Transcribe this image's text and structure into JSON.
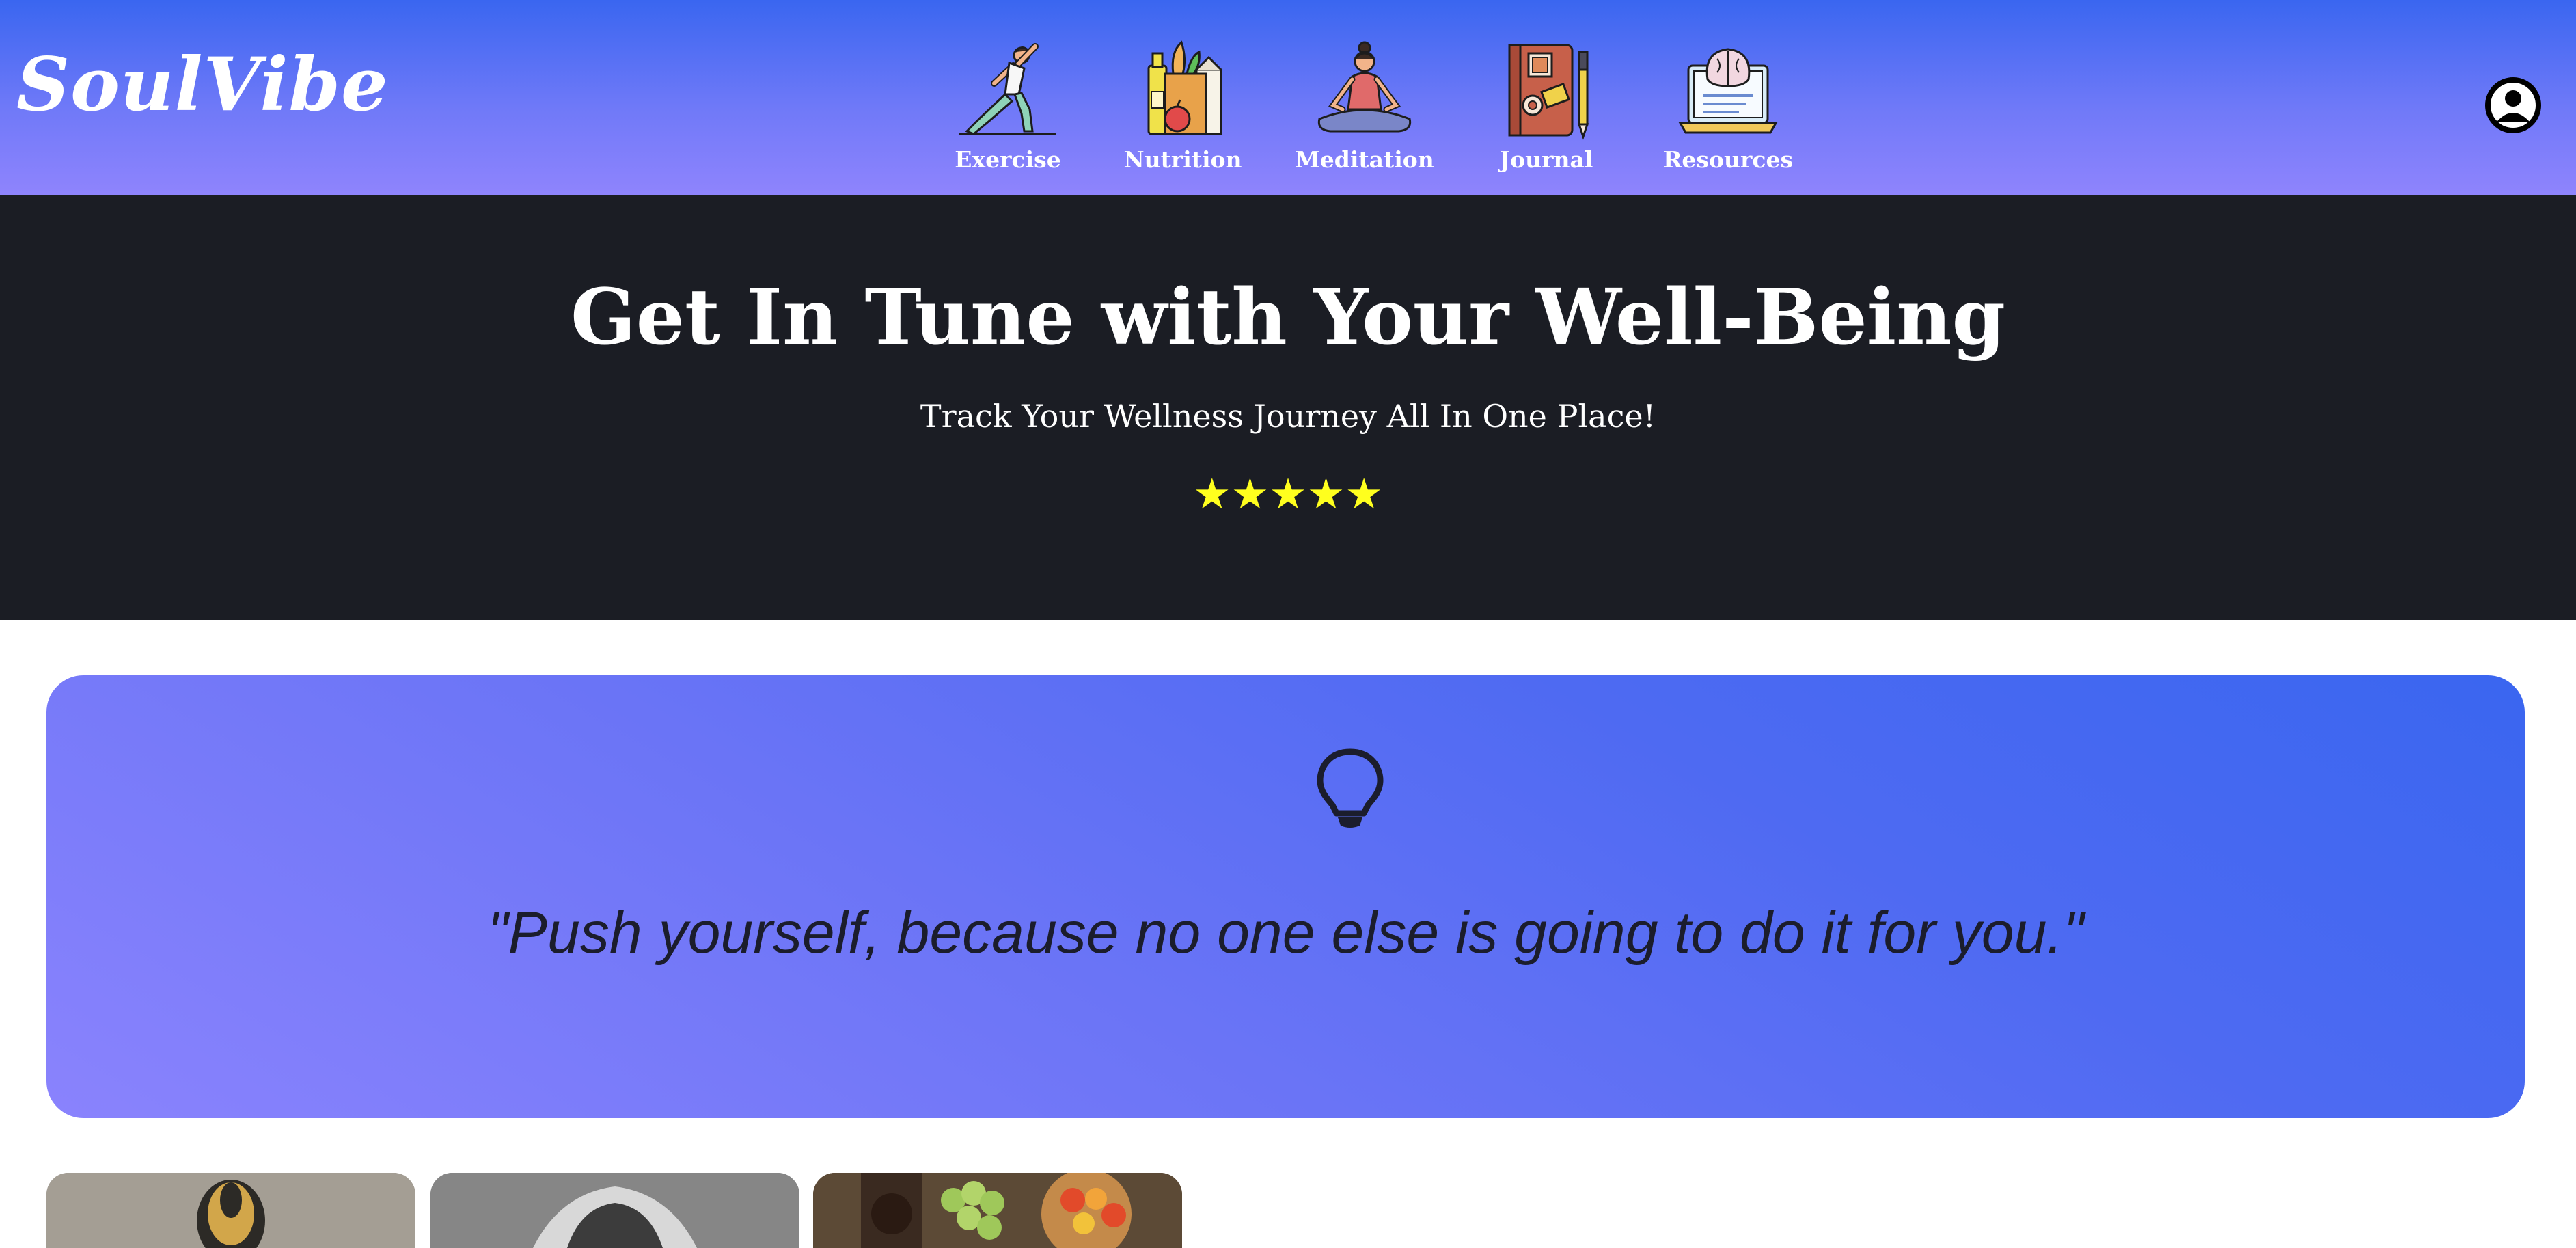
{
  "header": {
    "logo": "SoulVibe",
    "nav": [
      {
        "label": "Exercise",
        "icon": "exercise-icon"
      },
      {
        "label": "Nutrition",
        "icon": "nutrition-icon"
      },
      {
        "label": "Meditation",
        "icon": "meditation-icon"
      },
      {
        "label": "Journal",
        "icon": "journal-icon"
      },
      {
        "label": "Resources",
        "icon": "resources-icon"
      }
    ],
    "profile_icon": "user-circle-icon"
  },
  "hero": {
    "title": "Get In Tune with Your Well-Being",
    "subtitle": "Track Your Wellness Journey All In One Place!",
    "rating": 5,
    "stars": "★★★★★"
  },
  "quote": {
    "icon": "lightbulb-icon",
    "text": "\"Push yourself, because no one else is going to do it for you.\""
  },
  "cards": [
    {
      "image": "yoga-photo"
    },
    {
      "image": "portrait-photo"
    },
    {
      "image": "food-photo"
    }
  ],
  "colors": {
    "header_top": "#3a66f0",
    "header_bottom": "#8f84fd",
    "hero_background": "#1b1d24",
    "star": "#ffff1e",
    "quote_text": "#1b1d2c"
  }
}
